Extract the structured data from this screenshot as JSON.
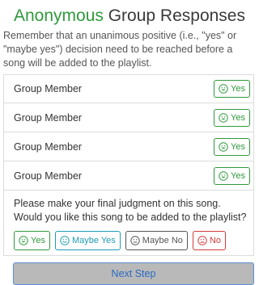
{
  "header": {
    "title_accent": "Anonymous",
    "title_rest": " Group Responses",
    "intro": "Remember that an unanimous positive (i.e., \"yes\" or \"maybe yes\") decision need to be reached before a song will be added to the playlist."
  },
  "members": [
    {
      "name": "Group Member",
      "response": "Yes"
    },
    {
      "name": "Group Member",
      "response": "Yes"
    },
    {
      "name": "Group Member",
      "response": "Yes"
    },
    {
      "name": "Group Member",
      "response": "Yes"
    }
  ],
  "judgment": {
    "line1": "Please make your final judgment on this song.",
    "line2": "Would you like this song to be added to the playlist?",
    "options": {
      "yes": "Yes",
      "maybe_yes": "Maybe Yes",
      "maybe_no": "Maybe No",
      "no": "No"
    }
  },
  "next_step": "Next Step",
  "icons": {
    "yes": "smile-icon",
    "maybe_yes": "slight-smile-icon",
    "maybe_no": "neutral-face-icon",
    "no": "frown-icon"
  },
  "colors": {
    "accent_green": "#2f9a3d",
    "maybe_yes_teal": "#1f9bb5",
    "maybe_no_gray": "#555555",
    "no_red": "#d33a3a",
    "next_button_bg": "#b9b9b9",
    "next_button_text": "#2a6ac0"
  }
}
